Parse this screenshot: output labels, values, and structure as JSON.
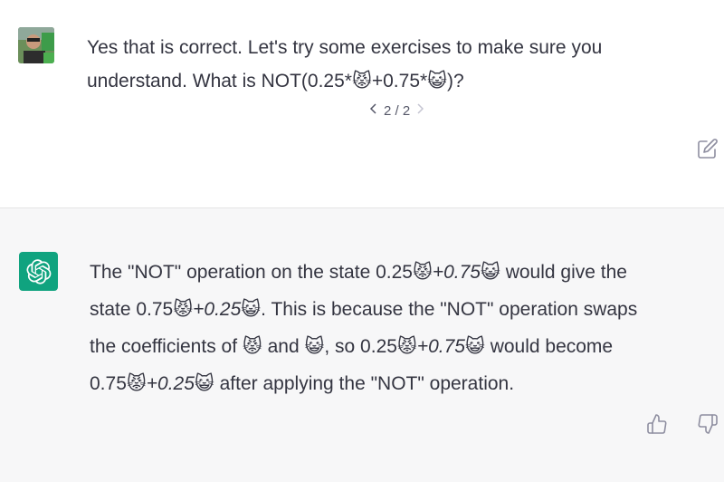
{
  "user_message": {
    "line1": "Yes that is correct. Let's try some exercises to make sure you",
    "line2": "understand. What is NOT(0.25*😾+0.75*😺)?"
  },
  "pager": {
    "prev_icon": "chevron-left-icon",
    "label": "2 / 2",
    "next_icon": "chevron-right-icon"
  },
  "assistant_message": {
    "p1_a": "The \"NOT\" operation on the state 0.25😾",
    "p1_b": "+0.75",
    "p1_c": "😺 would give the",
    "p2_a": "state 0.75😾",
    "p2_b": "+0.25",
    "p2_c": "😺. This is because the \"NOT\" operation swaps",
    "p3_a": "the coefficients of 😾 and 😺, so 0.25😾",
    "p3_b": "+0.75",
    "p3_c": "😺 would become",
    "p4_a": "0.75😾",
    "p4_b": "+0.25",
    "p4_c": "😺 after applying the \"NOT\" operation."
  },
  "colors": {
    "assistant_bg": "#f7f7f8",
    "avatar_green": "#10a37f",
    "text": "#343541"
  },
  "icons": {
    "edit": "edit-icon",
    "thumbs_up": "thumbs-up-icon",
    "thumbs_down": "thumbs-down-icon",
    "bot_avatar": "openai-logo-icon"
  }
}
